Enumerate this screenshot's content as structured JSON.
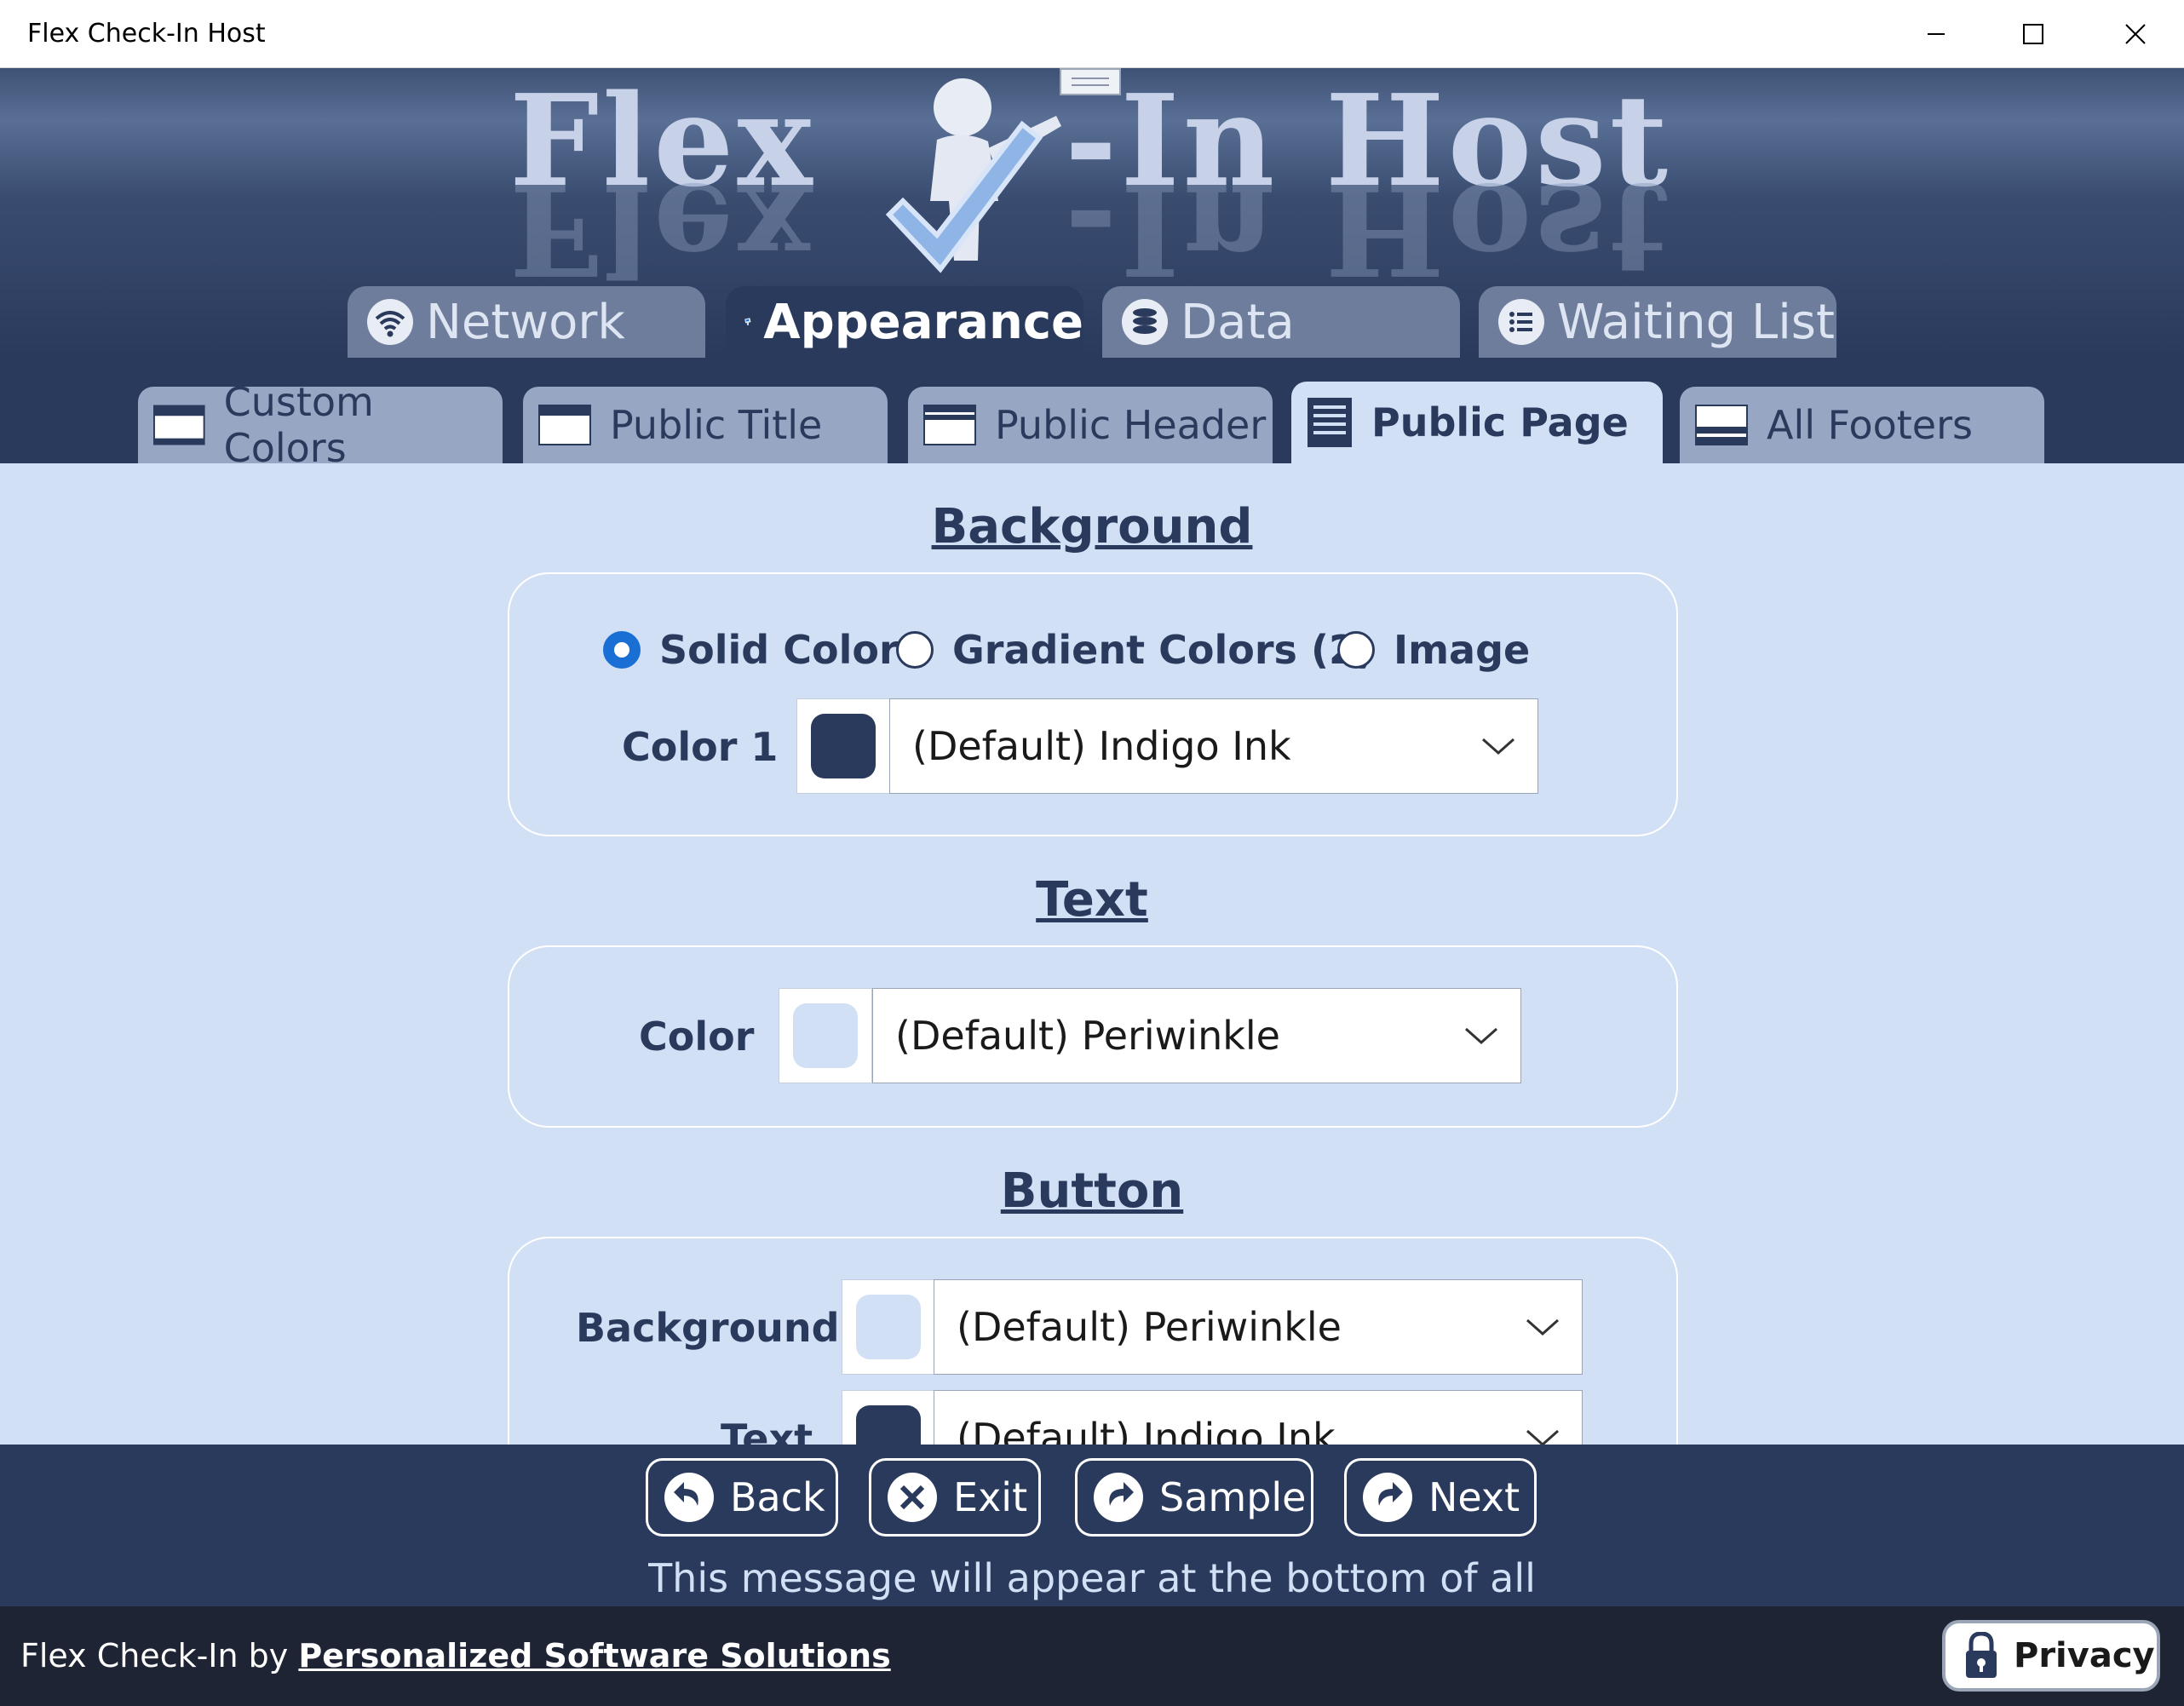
{
  "window": {
    "title": "Flex Check-In Host"
  },
  "banner": {
    "logo_left": "Flex",
    "logo_right": "-In Host"
  },
  "main_tabs": [
    {
      "label": "Network",
      "icon": "wifi-icon",
      "active": false
    },
    {
      "label": "Appearance",
      "icon": "kiosk-icon",
      "active": true
    },
    {
      "label": "Data",
      "icon": "database-icon",
      "active": false
    },
    {
      "label": "Waiting List",
      "icon": "list-icon",
      "active": false
    }
  ],
  "sub_tabs": [
    {
      "label": "Custom Colors",
      "active": false
    },
    {
      "label": "Public Title",
      "active": false
    },
    {
      "label": "Public Header",
      "active": false
    },
    {
      "label": "Public Page",
      "active": true
    },
    {
      "label": "All Footers",
      "active": false
    }
  ],
  "background_section": {
    "title": "Background",
    "radios": [
      {
        "label": "Solid Color",
        "checked": true
      },
      {
        "label": "Gradient Colors (2)",
        "checked": false
      },
      {
        "label": "Image",
        "checked": false
      }
    ],
    "color1_label": "Color 1",
    "color1_value": "(Default) Indigo Ink",
    "color1_swatch": "#2a3a5c"
  },
  "text_section": {
    "title": "Text",
    "color_label": "Color",
    "color_value": "(Default) Periwinkle",
    "color_swatch": "#d2e0f6"
  },
  "button_section": {
    "title": "Button",
    "background_label": "Background",
    "background_value": "(Default) Periwinkle",
    "background_swatch": "#d2e0f6",
    "text_label": "Text",
    "text_value": "(Default) Indigo Ink",
    "text_swatch": "#2a3a5c"
  },
  "nav": {
    "back": "Back",
    "exit": "Exit",
    "sample": "Sample",
    "next": "Next"
  },
  "footer_message": "This message will appear at the bottom of all",
  "credit": {
    "prefix": "Flex Check-In by",
    "company": "Personalized Software Solutions"
  },
  "privacy_label": "Privacy",
  "colors": {
    "indigo_ink": "#2a3a5c",
    "periwinkle": "#d2e0f6",
    "accent_blue": "#1a6fd4"
  }
}
